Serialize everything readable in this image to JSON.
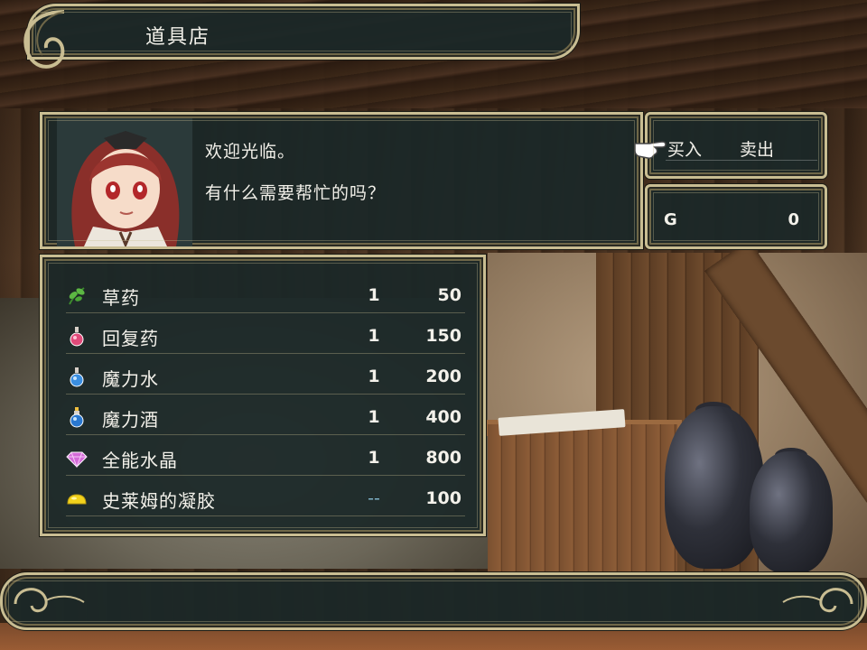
{
  "title": "道具店",
  "message": {
    "lines": [
      "欢迎光临。",
      "有什么需要帮忙的吗？"
    ]
  },
  "commands": {
    "buy": "买入",
    "sell": "卖出",
    "selected": "buy"
  },
  "gold": {
    "label": "G",
    "value": "0"
  },
  "items": [
    {
      "name": "草药",
      "qty": "1",
      "price": "50",
      "icon": "herb-icon"
    },
    {
      "name": "回复药",
      "qty": "1",
      "price": "150",
      "icon": "red-potion-icon"
    },
    {
      "name": "魔力水",
      "qty": "1",
      "price": "200",
      "icon": "blue-potion-icon"
    },
    {
      "name": "魔力酒",
      "qty": "1",
      "price": "400",
      "icon": "blue-elixir-icon"
    },
    {
      "name": "全能水晶",
      "qty": "1",
      "price": "800",
      "icon": "crystal-icon"
    },
    {
      "name": "史莱姆的凝胶",
      "qty": "--",
      "price": "100",
      "icon": "slime-gel-icon"
    }
  ],
  "colors": {
    "window_bg": "#1b2828",
    "frame_gold": "#c9bd92",
    "text": "#f3f1ea",
    "dim_qty": "#7fb3c9"
  }
}
